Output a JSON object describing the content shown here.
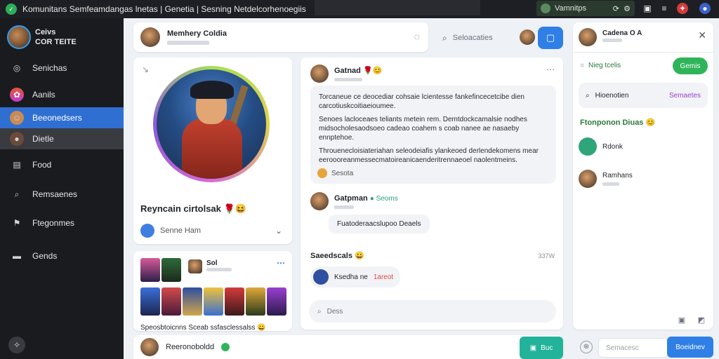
{
  "window": {
    "title": "Komunitans Semfeamdangas lnetas | Genetia | Sesning Netdelcorhenoegiis",
    "status_label": "Vamnitps"
  },
  "sidebar": {
    "profile": {
      "name_line1": "Ceivs",
      "name_line2": "COR TEITE"
    },
    "items": [
      {
        "label": "Senichas",
        "icon": "compass-icon"
      },
      {
        "label": "Aanils",
        "icon": "app-icon"
      },
      {
        "label": "Beeonedsers",
        "icon": "people-icon"
      },
      {
        "label": "Dietle",
        "icon": "avatar-icon"
      },
      {
        "label": "Food",
        "icon": "gamepad-icon"
      },
      {
        "label": "Remsaenes",
        "icon": "search-icon"
      },
      {
        "label": "Ftegonmes",
        "icon": "flag-icon"
      },
      {
        "label": "Gends",
        "icon": "folder-icon"
      }
    ]
  },
  "header": {
    "name": "Memhery Coldia",
    "search_placeholder": "Seloacaties"
  },
  "hero": {
    "name": "Reyncain cirtolsak"
  },
  "hero_action": {
    "label": "Senne Ham"
  },
  "grid": {
    "title": "Sol",
    "caption": "Speosbtoicnns Sceab ssfasclessalss"
  },
  "feed": {
    "author": "Gatnad",
    "paragraphs": [
      "Torcaneue ce deocediar cohsaie lcientesse fankefincecetcibe dien carcotiuskcoitiaeioumee.",
      "Senoes lacloceaes teliants metein rem. Demtdockcamalsie nodhes midsocholesaodsoeo cadeao coahem s coab nanee ae nasaeby ennptehoe.",
      "Throuenecloisiateriahan seleodeiafis ylankeoed derlendekomens mear eeroooreanmessecmatoireanicaenderitrennaeoel naolentmeins."
    ],
    "reaction_label": "Sesota",
    "comment": {
      "author": "Gatpman",
      "badge": "Seoms",
      "text": "Fuatoderaacslupoo Deaels"
    },
    "section_title": "Saeedscals",
    "section_time": "337W",
    "mention_text": "Ksedha ne",
    "mention_tag": "1areot",
    "input_placeholder": "Dess"
  },
  "right_panel": {
    "name": "Cadena O A",
    "follow_row_label": "Nieg tcelis",
    "follow_button": "Gemis",
    "search_text": "Hioenotien",
    "search_tag": "Semaetes",
    "heading": "Ftonponon Diuas",
    "contacts": [
      {
        "name": "Rdonk"
      },
      {
        "name": "Ramhans"
      }
    ]
  },
  "bottom_bar": {
    "name": "Reeronoboldd",
    "button": "Buc"
  },
  "composer": {
    "placeholder": "Semacesc",
    "send": "Boeidnev"
  }
}
